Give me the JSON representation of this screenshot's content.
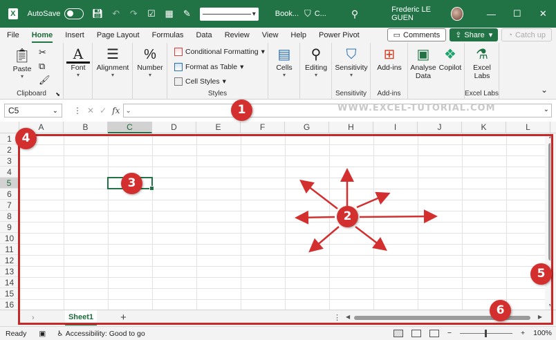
{
  "titlebar": {
    "autosave_label": "AutoSave",
    "doc_title": "Book...",
    "sensitivity_label": "C...",
    "user_name": "Frederic LE GUEN",
    "logo_text": "X"
  },
  "menu": {
    "tabs": [
      "File",
      "Home",
      "Insert",
      "Page Layout",
      "Formulas",
      "Data",
      "Review",
      "View",
      "Help",
      "Power Pivot"
    ],
    "active_tab": "Home",
    "comments_label": "Comments",
    "share_label": "Share",
    "catchup_label": "Catch up"
  },
  "ribbon": {
    "clipboard": {
      "paste_label": "Paste",
      "group_label": "Clipboard"
    },
    "font": {
      "label": "Font"
    },
    "alignment": {
      "label": "Alignment"
    },
    "number": {
      "label": "Number"
    },
    "styles": {
      "conditional_formatting": "Conditional Formatting",
      "format_as_table": "Format as Table",
      "cell_styles": "Cell Styles",
      "group_label": "Styles"
    },
    "cells": {
      "label": "Cells"
    },
    "editing": {
      "label": "Editing"
    },
    "sensitivity": {
      "label": "Sensitivity",
      "group_label": "Sensitivity"
    },
    "addins": {
      "label": "Add-ins",
      "group_label": "Add-ins"
    },
    "analyse_data": {
      "label_line1": "Analyse",
      "label_line2": "Data"
    },
    "copilot": {
      "label": "Copilot"
    },
    "excel_labs": {
      "label_line1": "Excel",
      "label_line2": "Labs",
      "group_label": "Excel Labs"
    }
  },
  "formula_bar": {
    "name_box": "C5",
    "fx_label": "fx",
    "watermark": "WWW.EXCEL-TUTORIAL.COM"
  },
  "grid": {
    "columns": [
      "A",
      "B",
      "C",
      "D",
      "E",
      "F",
      "G",
      "H",
      "I",
      "J",
      "K",
      "L"
    ],
    "rows": [
      "1",
      "2",
      "3",
      "4",
      "5",
      "6",
      "7",
      "8",
      "9",
      "10",
      "11",
      "12",
      "13",
      "14",
      "15",
      "16"
    ],
    "selected_cell": "C5"
  },
  "sheets": {
    "tabs": [
      "Sheet1"
    ],
    "add_label": "+"
  },
  "status": {
    "ready": "Ready",
    "accessibility": "Accessibility: Good to go",
    "zoom": "100%"
  },
  "callouts": [
    "1",
    "2",
    "3",
    "4",
    "5",
    "6"
  ],
  "colors": {
    "excel_green": "#217346",
    "callout_red": "#d32f2f"
  }
}
